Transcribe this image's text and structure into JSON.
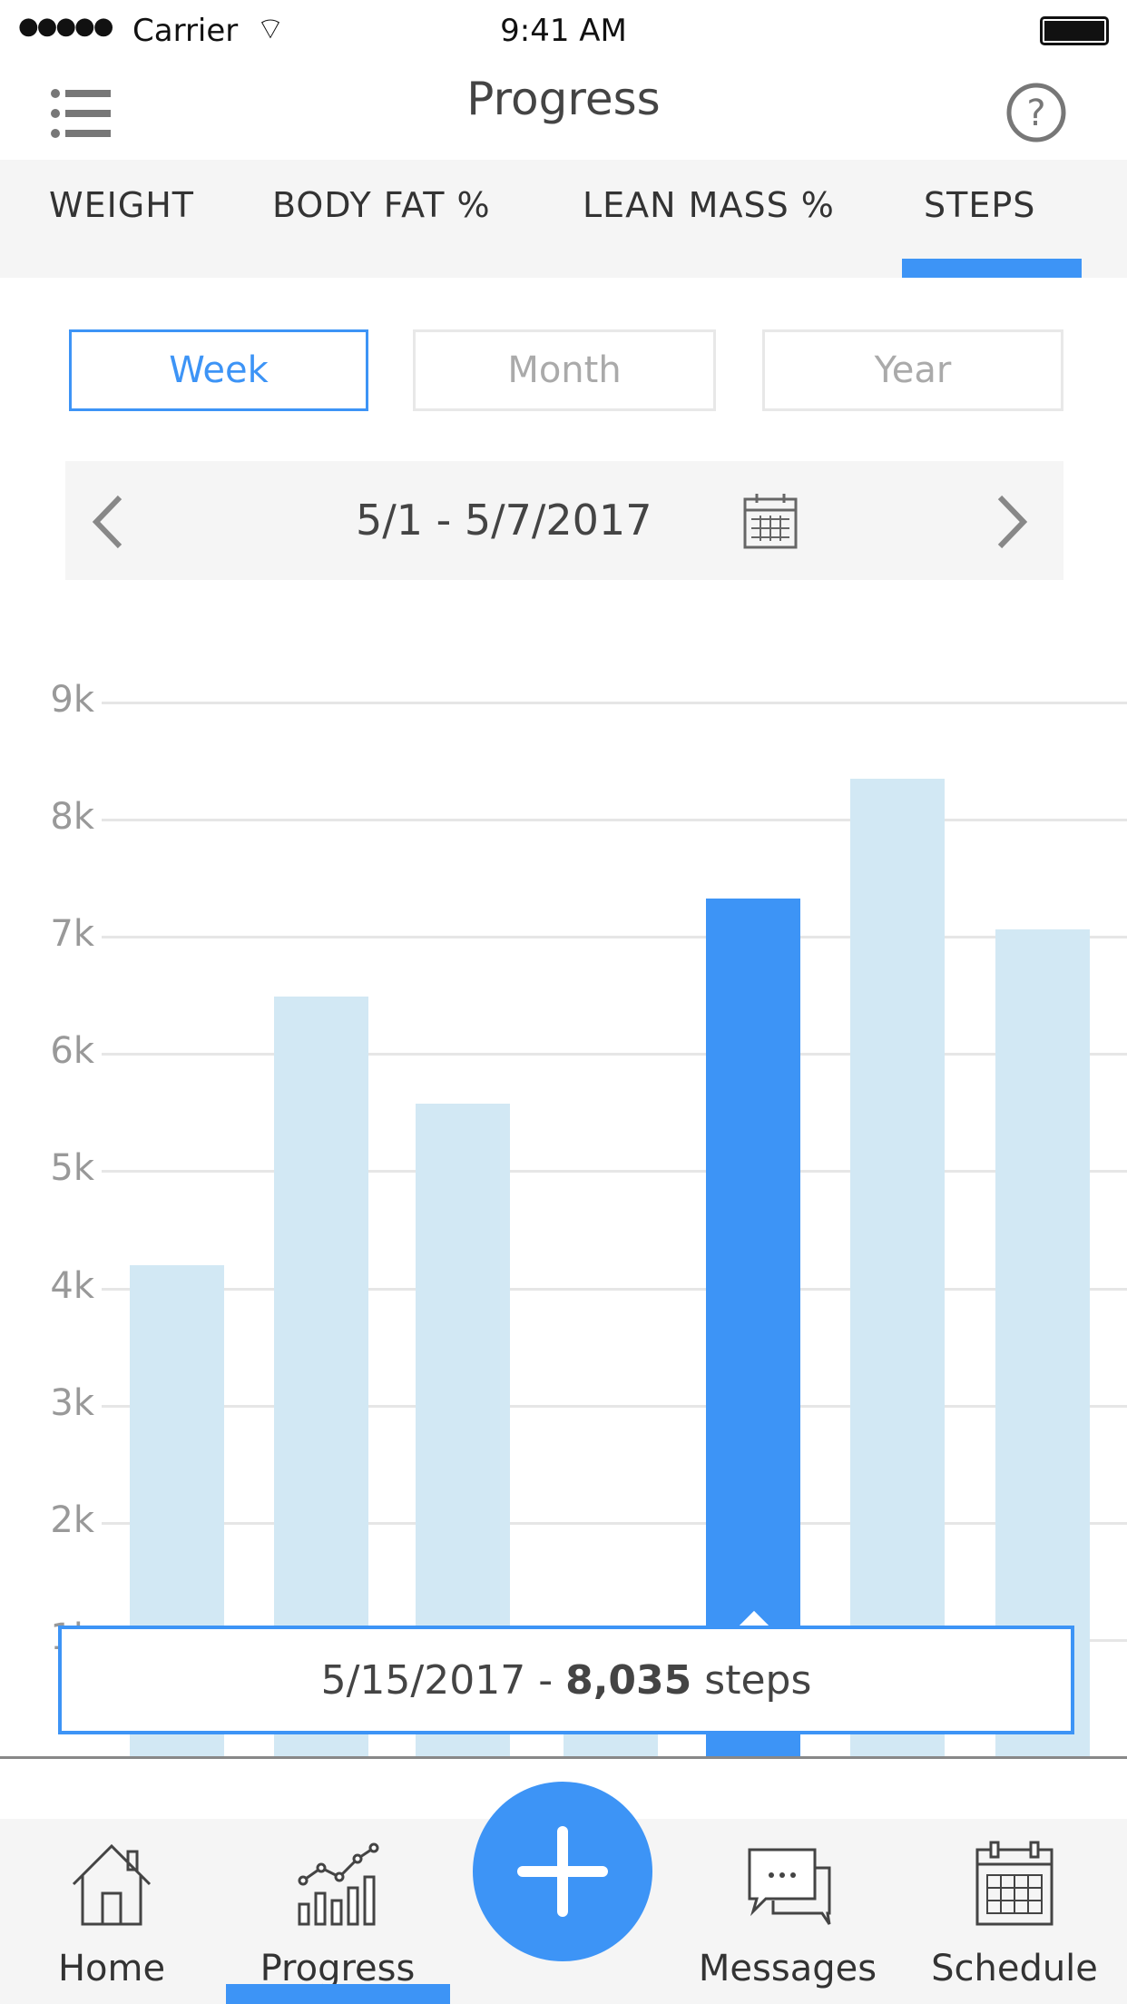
{
  "status_bar": {
    "carrier": "Carrier",
    "time": "9:41 AM"
  },
  "header": {
    "title": "Progress",
    "menu_icon": "list-icon",
    "help_icon": "question-circle-icon"
  },
  "tabs": [
    {
      "label": "WEIGHT"
    },
    {
      "label": "BODY FAT %"
    },
    {
      "label": "LEAN MASS %"
    },
    {
      "label": "STEPS",
      "active": true
    }
  ],
  "periods": [
    {
      "label": "Week",
      "active": true
    },
    {
      "label": "Month"
    },
    {
      "label": "Year"
    }
  ],
  "date_range": "5/1 - 5/7/2017",
  "colors": {
    "accent": "#3d94f6",
    "bar": "#d2e8f4",
    "bar_selected": "#3d94f6"
  },
  "chart_data": {
    "type": "bar",
    "categories": [
      "",
      "",
      "",
      "",
      "",
      "",
      ""
    ],
    "values": [
      4200,
      6490,
      5580,
      400,
      7330,
      8350,
      7060
    ],
    "selected_index": 4,
    "ylim": [
      0,
      9000
    ],
    "yticks": [
      "1k",
      "2k",
      "3k",
      "4k",
      "5k",
      "6k",
      "7k",
      "8k",
      "9k"
    ],
    "grid": true
  },
  "tooltip": {
    "date": "5/15/2017 -",
    "value": "8,035",
    "unit": "steps"
  },
  "bottom_nav": [
    {
      "label": "Home",
      "icon": "home-icon"
    },
    {
      "label": "Progress",
      "icon": "chart-icon",
      "active": true
    },
    {
      "label": "",
      "icon": "plus-icon"
    },
    {
      "label": "Messages",
      "icon": "chat-icon"
    },
    {
      "label": "Schedule",
      "icon": "calendar-icon"
    }
  ]
}
